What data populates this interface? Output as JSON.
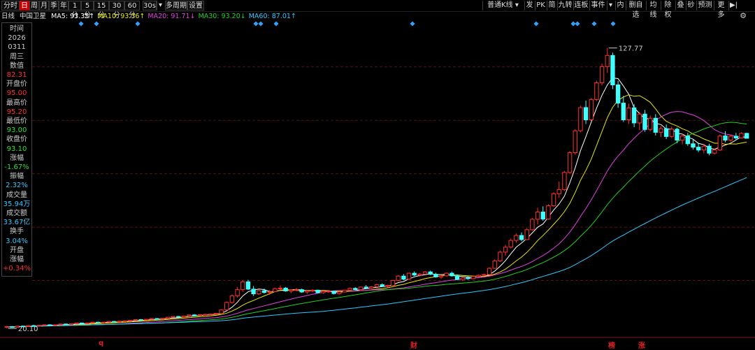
{
  "toolbar": {
    "periods": [
      {
        "label": "分时",
        "selected": false
      },
      {
        "label": "日",
        "selected": true
      },
      {
        "label": "周",
        "selected": false
      },
      {
        "label": "月",
        "selected": false
      },
      {
        "label": "季",
        "selected": false
      },
      {
        "label": "年",
        "selected": false
      },
      {
        "label": "1分",
        "selected": false
      },
      {
        "label": "5分",
        "selected": false
      },
      {
        "label": "15分",
        "selected": false
      },
      {
        "label": "30分",
        "selected": false
      },
      {
        "label": "60分",
        "selected": false
      },
      {
        "label": "30s",
        "selected": false
      },
      {
        "label": "多周期",
        "selected": false
      },
      {
        "label": "设置",
        "selected": false
      }
    ],
    "kline_mode": "普通K线",
    "right_items": [
      "发",
      "PK",
      "简",
      "九转",
      "连板",
      "事件",
      "内",
      "删自选",
      "均线",
      "除权",
      "叠",
      "砂",
      "预测",
      "更多"
    ]
  },
  "legend": {
    "period": "日线",
    "name": "中国卫星",
    "ma": [
      {
        "label": "MA5: 93.35↑",
        "color": "#ffffff"
      },
      {
        "label": "MA10: 93.36↑",
        "color": "#e8e800"
      },
      {
        "label": "MA20: 91.71↓",
        "color": "#e040e0"
      },
      {
        "label": "MA30: 93.20↓",
        "color": "#20d020"
      },
      {
        "label": "MA60: 87.01↑",
        "color": "#30c8ff"
      }
    ]
  },
  "info_panel": [
    {
      "label": "时间",
      "color": "#cccccc"
    },
    {
      "label": "2026",
      "color": "#cccccc"
    },
    {
      "label": "0311",
      "color": "#cccccc"
    },
    {
      "label": "周三",
      "color": "#cccccc"
    },
    {
      "label": "数值",
      "color": "#cccccc"
    },
    {
      "label": "82.31",
      "color": "#ff3030"
    },
    {
      "label": "开盘价",
      "color": "#cccccc"
    },
    {
      "label": "95.00",
      "color": "#ff3030"
    },
    {
      "label": "最高价",
      "color": "#cccccc"
    },
    {
      "label": "95.20",
      "color": "#ff3030"
    },
    {
      "label": "最低价",
      "color": "#cccccc"
    },
    {
      "label": "93.00",
      "color": "#30e030"
    },
    {
      "label": "收盘价",
      "color": "#cccccc"
    },
    {
      "label": "93.10",
      "color": "#30e030"
    },
    {
      "label": "涨幅",
      "color": "#cccccc"
    },
    {
      "label": "-1.67%",
      "color": "#30e030"
    },
    {
      "label": "振幅",
      "color": "#cccccc"
    },
    {
      "label": "2.32%",
      "color": "#30c8ff"
    },
    {
      "label": "成交量",
      "color": "#cccccc"
    },
    {
      "label": "35.94万",
      "color": "#30c8ff"
    },
    {
      "label": "成交额",
      "color": "#cccccc"
    },
    {
      "label": "33.67亿",
      "color": "#30c8ff"
    },
    {
      "label": "换手",
      "color": "#cccccc"
    },
    {
      "label": "3.04%",
      "color": "#30c8ff"
    },
    {
      "label": "开盘",
      "color": "#cccccc"
    },
    {
      "label": "涨幅",
      "color": "#cccccc"
    },
    {
      "label": "+0.34%",
      "color": "#ff3030"
    }
  ],
  "chart_data": {
    "type": "candlestick",
    "high_label": "127.77",
    "low_label": "20.10",
    "ylim": [
      18,
      136
    ],
    "grid_levels": [
      38.5,
      59,
      79.5,
      100,
      120.5
    ],
    "event_markers": [
      "q",
      "财",
      "榜",
      "涨"
    ],
    "candles": [
      [
        20.5,
        20.9,
        20.1,
        20.8
      ],
      [
        20.8,
        21.0,
        20.4,
        20.6
      ],
      [
        20.6,
        21.1,
        20.5,
        21.0
      ],
      [
        21.0,
        21.2,
        20.7,
        20.9
      ],
      [
        20.9,
        21.3,
        20.8,
        21.2
      ],
      [
        21.2,
        21.5,
        21.0,
        21.1
      ],
      [
        21.1,
        21.4,
        20.9,
        21.3
      ],
      [
        21.3,
        21.6,
        21.1,
        21.5
      ],
      [
        21.5,
        21.7,
        21.2,
        21.3
      ],
      [
        21.3,
        21.6,
        21.1,
        21.5
      ],
      [
        21.5,
        21.9,
        21.4,
        21.8
      ],
      [
        21.8,
        22.0,
        21.5,
        21.6
      ],
      [
        21.6,
        22.0,
        21.5,
        21.9
      ],
      [
        21.9,
        22.3,
        21.8,
        22.2
      ],
      [
        22.2,
        22.4,
        21.9,
        22.0
      ],
      [
        22.0,
        22.3,
        21.8,
        22.2
      ],
      [
        22.2,
        22.6,
        22.1,
        22.5
      ],
      [
        22.5,
        22.7,
        22.2,
        22.3
      ],
      [
        22.3,
        22.6,
        22.1,
        22.5
      ],
      [
        22.5,
        22.9,
        22.4,
        22.8
      ],
      [
        22.8,
        23.0,
        22.5,
        22.6
      ],
      [
        22.6,
        23.0,
        22.5,
        22.9
      ],
      [
        22.9,
        23.2,
        22.7,
        23.0
      ],
      [
        23.0,
        23.3,
        22.8,
        23.2
      ],
      [
        23.2,
        23.6,
        23.1,
        23.5
      ],
      [
        23.5,
        23.7,
        23.2,
        23.3
      ],
      [
        23.3,
        23.7,
        23.2,
        23.6
      ],
      [
        23.6,
        24.0,
        23.5,
        23.9
      ],
      [
        23.9,
        24.1,
        23.6,
        23.7
      ],
      [
        23.7,
        24.1,
        23.6,
        24.0
      ],
      [
        24.0,
        24.5,
        23.9,
        24.4
      ],
      [
        24.4,
        24.8,
        24.3,
        24.7
      ],
      [
        24.7,
        24.9,
        24.3,
        24.5
      ],
      [
        24.5,
        25.0,
        24.4,
        24.9
      ],
      [
        24.9,
        25.4,
        24.8,
        25.3
      ],
      [
        25.3,
        25.6,
        25.0,
        25.2
      ],
      [
        25.2,
        25.5,
        25.1,
        25.4
      ],
      [
        25.4,
        25.7,
        25.2,
        25.5
      ],
      [
        25.5,
        25.8,
        25.3,
        25.6
      ],
      [
        25.6,
        26.0,
        25.4,
        25.9
      ],
      [
        25.9,
        27.5,
        25.8,
        27.2
      ],
      [
        27.2,
        30.5,
        27.0,
        30.1
      ],
      [
        30.1,
        33.2,
        29.6,
        32.6
      ],
      [
        32.6,
        36.0,
        32.0,
        35.0
      ],
      [
        35.0,
        38.7,
        34.2,
        38.0
      ],
      [
        38.0,
        38.8,
        34.8,
        35.2
      ],
      [
        35.2,
        36.4,
        32.6,
        33.4
      ],
      [
        33.4,
        35.0,
        32.9,
        34.6
      ],
      [
        34.6,
        35.4,
        33.5,
        33.9
      ],
      [
        33.9,
        34.8,
        33.0,
        34.2
      ],
      [
        34.2,
        35.8,
        34.0,
        35.4
      ],
      [
        35.4,
        36.6,
        34.8,
        35.6
      ],
      [
        35.6,
        36.0,
        34.2,
        34.5
      ],
      [
        34.5,
        35.2,
        33.6,
        34.9
      ],
      [
        34.9,
        35.6,
        34.4,
        35.0
      ],
      [
        35.0,
        35.4,
        33.8,
        34.1
      ],
      [
        34.1,
        34.8,
        33.4,
        34.5
      ],
      [
        34.5,
        35.2,
        34.0,
        34.8
      ],
      [
        34.8,
        35.0,
        33.6,
        33.8
      ],
      [
        33.8,
        34.6,
        33.4,
        34.3
      ],
      [
        34.3,
        34.9,
        33.8,
        34.4
      ],
      [
        34.4,
        34.6,
        33.2,
        33.5
      ],
      [
        33.5,
        34.3,
        33.1,
        34.1
      ],
      [
        34.1,
        35.0,
        33.9,
        34.8
      ],
      [
        34.8,
        35.8,
        34.6,
        35.5
      ],
      [
        35.5,
        35.9,
        34.8,
        35.0
      ],
      [
        35.0,
        36.2,
        34.9,
        36.0
      ],
      [
        36.0,
        36.8,
        35.4,
        35.6
      ],
      [
        35.6,
        36.4,
        35.3,
        36.1
      ],
      [
        36.1,
        37.2,
        35.9,
        36.9
      ],
      [
        36.9,
        37.4,
        36.0,
        36.3
      ],
      [
        36.3,
        36.9,
        35.8,
        36.6
      ],
      [
        36.6,
        38.8,
        36.5,
        38.5
      ],
      [
        38.5,
        40.6,
        38.2,
        40.2
      ],
      [
        40.2,
        41.0,
        38.6,
        39.0
      ],
      [
        39.0,
        41.6,
        38.8,
        41.3
      ],
      [
        41.3,
        42.0,
        40.2,
        40.6
      ],
      [
        40.6,
        41.4,
        40.0,
        41.0
      ],
      [
        41.0,
        42.2,
        40.7,
        41.8
      ],
      [
        41.8,
        42.3,
        40.6,
        40.9
      ],
      [
        40.9,
        41.5,
        39.6,
        39.9
      ],
      [
        39.9,
        40.6,
        39.2,
        40.3
      ],
      [
        40.3,
        41.6,
        40.1,
        41.3
      ],
      [
        41.3,
        41.9,
        40.0,
        40.3
      ],
      [
        40.3,
        40.9,
        38.6,
        38.9
      ],
      [
        38.9,
        39.8,
        38.4,
        39.5
      ],
      [
        39.5,
        40.2,
        38.8,
        39.2
      ],
      [
        39.2,
        40.4,
        39.0,
        40.1
      ],
      [
        40.1,
        40.8,
        39.7,
        40.5
      ],
      [
        40.5,
        41.2,
        40.2,
        40.8
      ],
      [
        40.8,
        43.6,
        40.6,
        43.2
      ],
      [
        43.2,
        46.6,
        43.0,
        46.0
      ],
      [
        46.0,
        50.0,
        45.6,
        49.4
      ],
      [
        49.4,
        52.2,
        48.0,
        51.3
      ],
      [
        51.3,
        54.6,
        50.8,
        53.9
      ],
      [
        53.9,
        56.6,
        53.0,
        55.8
      ],
      [
        55.8,
        57.0,
        53.6,
        54.2
      ],
      [
        54.2,
        58.6,
        54.0,
        58.0
      ],
      [
        58.0,
        62.6,
        57.6,
        62.0
      ],
      [
        62.0,
        66.4,
        60.0,
        64.8
      ],
      [
        64.8,
        67.0,
        61.4,
        62.1
      ],
      [
        62.1,
        67.8,
        61.8,
        67.2
      ],
      [
        67.2,
        72.4,
        66.8,
        71.8
      ],
      [
        71.8,
        76.5,
        70.2,
        73.4
      ],
      [
        73.4,
        80.6,
        72.9,
        80.0
      ],
      [
        80.0,
        88.2,
        79.4,
        87.6
      ],
      [
        87.6,
        96.6,
        86.8,
        96.0
      ],
      [
        96.0,
        105.6,
        95.4,
        104.9
      ],
      [
        104.9,
        107.6,
        98.6,
        100.2
      ],
      [
        100.2,
        108.6,
        99.8,
        108.0
      ],
      [
        108.0,
        115.2,
        107.4,
        114.4
      ],
      [
        114.4,
        121.8,
        113.4,
        120.6
      ],
      [
        120.6,
        127.77,
        118.2,
        124.9
      ],
      [
        124.9,
        126.0,
        112.0,
        113.6
      ],
      [
        113.6,
        115.2,
        104.8,
        106.6
      ],
      [
        106.6,
        109.4,
        99.4,
        100.2
      ],
      [
        100.2,
        106.4,
        98.6,
        104.8
      ],
      [
        104.8,
        106.2,
        97.4,
        99.0
      ],
      [
        99.0,
        103.2,
        96.2,
        102.4
      ],
      [
        102.4,
        104.0,
        95.6,
        96.5
      ],
      [
        96.5,
        101.8,
        95.8,
        100.8
      ],
      [
        100.8,
        102.4,
        94.2,
        95.4
      ],
      [
        95.4,
        97.8,
        93.6,
        96.8
      ],
      [
        96.8,
        98.4,
        92.8,
        93.8
      ],
      [
        93.8,
        97.6,
        93.2,
        96.6
      ],
      [
        96.6,
        97.2,
        91.2,
        92.4
      ],
      [
        92.4,
        94.8,
        90.8,
        94.0
      ],
      [
        94.0,
        95.2,
        90.2,
        91.0
      ],
      [
        91.0,
        92.6,
        88.8,
        89.7
      ],
      [
        89.7,
        91.4,
        87.8,
        88.6
      ],
      [
        88.6,
        90.8,
        87.4,
        90.1
      ],
      [
        90.1,
        91.0,
        86.6,
        87.4
      ],
      [
        87.4,
        89.2,
        86.8,
        88.6
      ],
      [
        88.6,
        94.6,
        88.2,
        94.0
      ],
      [
        94.0,
        95.8,
        91.6,
        92.4
      ],
      [
        92.4,
        94.4,
        91.8,
        93.9
      ],
      [
        93.9,
        95.2,
        92.4,
        93.2
      ],
      [
        93.2,
        95.4,
        93.0,
        95.0
      ],
      [
        95.0,
        95.2,
        93.0,
        93.1
      ]
    ],
    "ma_periods": [
      5,
      10,
      20,
      30,
      60
    ],
    "ma_colors": [
      "#ffffff",
      "#e8e800",
      "#e040e0",
      "#20d020",
      "#30c8ff"
    ],
    "up_color": "#ff3030",
    "down_color": "#40ffff",
    "event_colors": [
      "#30a0ff"
    ]
  }
}
